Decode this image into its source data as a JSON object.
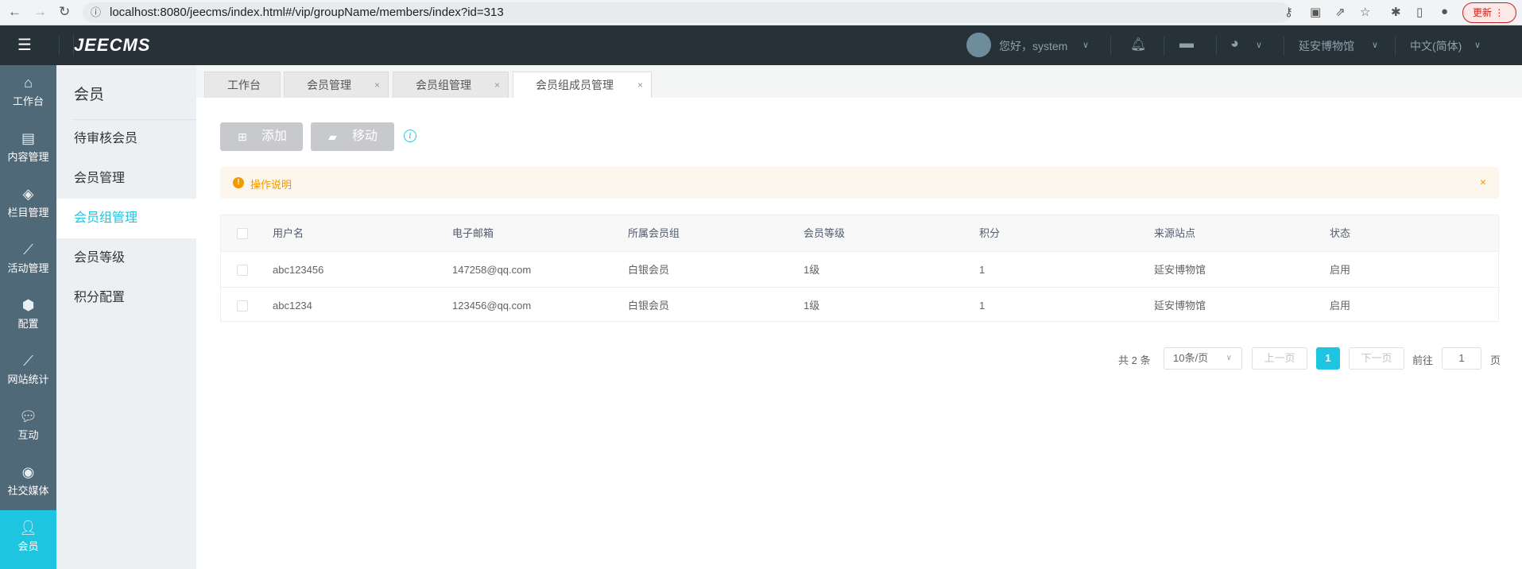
{
  "browser": {
    "url": "localhost:8080/jeecms/index.html#/vip/groupName/members/index?id=313",
    "update_label": "更新"
  },
  "header": {
    "logo": "JEECMS",
    "greeting": "您好，system",
    "site": "延安博物馆",
    "language": "中文(简体)"
  },
  "rail": [
    {
      "label": "工作台",
      "icon": "home-icon"
    },
    {
      "label": "内容管理",
      "icon": "document-icon"
    },
    {
      "label": "栏目管理",
      "icon": "layers-icon"
    },
    {
      "label": "活动管理",
      "icon": "line-chart-icon"
    },
    {
      "label": "配置",
      "icon": "box-icon"
    },
    {
      "label": "网站统计",
      "icon": "line-chart-icon"
    },
    {
      "label": "互动",
      "icon": "chat-icon"
    },
    {
      "label": "社交媒体",
      "icon": "target-icon"
    },
    {
      "label": "会员",
      "icon": "member-icon"
    }
  ],
  "submenu": {
    "title": "会员",
    "items": [
      "待审核会员",
      "会员管理",
      "会员组管理",
      "会员等级",
      "积分配置"
    ]
  },
  "tabs": [
    "工作台",
    "会员管理",
    "会员组管理",
    "会员组成员管理"
  ],
  "toolbar": {
    "add": "添加",
    "move": "移动",
    "info": "i"
  },
  "alert": {
    "text": "操作说明",
    "close": "×"
  },
  "table": {
    "headers": [
      "用户名",
      "电子邮箱",
      "所属会员组",
      "会员等级",
      "积分",
      "来源站点",
      "状态"
    ],
    "rows": [
      [
        "abc123456",
        "147258@qq.com",
        "白银会员",
        "1级",
        "1",
        "延安博物馆",
        "启用"
      ],
      [
        "abc1234",
        "123456@qq.com",
        "白银会员",
        "1级",
        "1",
        "延安博物馆",
        "启用"
      ]
    ]
  },
  "pagination": {
    "total": "共 2 条",
    "page_size": "10条/页",
    "prev": "上一页",
    "current": "1",
    "next": "下一页",
    "goto": "前往",
    "goto_value": "1",
    "page_suffix": "页"
  },
  "colors": {
    "accent": "#1ec5e0",
    "rail": "#506978",
    "header": "#263238"
  }
}
